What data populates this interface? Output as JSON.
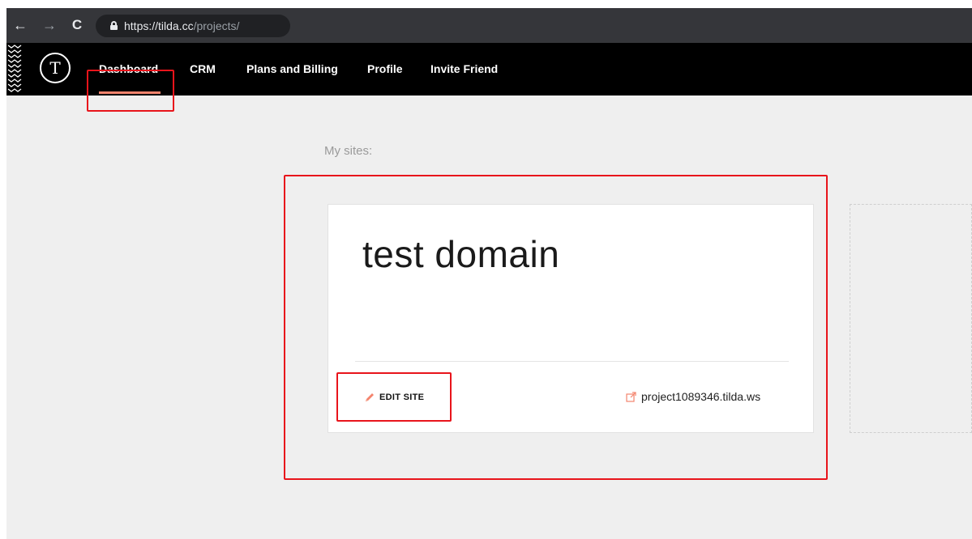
{
  "browser": {
    "url_host": "https://tilda.cc",
    "url_path": "/projects/"
  },
  "icons": {
    "back": "arrow-left-icon",
    "forward": "arrow-right-icon",
    "reload": "reload-icon",
    "lock": "lock-icon",
    "logo": "tilda-logo",
    "pencil": "pencil-icon",
    "external": "external-link-icon"
  },
  "nav": {
    "logo_glyph": "T",
    "dashboard": "Dashboard",
    "crm": "CRM",
    "plans": "Plans and Billing",
    "profile": "Profile",
    "invite": "Invite Friend"
  },
  "main": {
    "section_label": "My sites:",
    "site": {
      "title": "test domain",
      "edit_label": "EDIT SITE",
      "url": "project1089346.tilda.ws"
    }
  },
  "colors": {
    "accent": "#f4846d",
    "annotation": "#e8141b"
  }
}
